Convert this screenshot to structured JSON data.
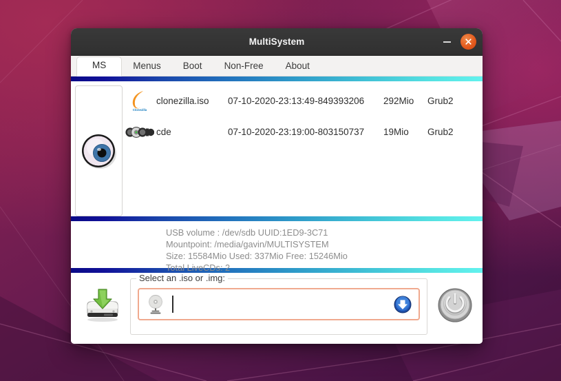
{
  "window": {
    "title": "MultiSystem",
    "minimize_label": "Minimize",
    "close_label": "Close"
  },
  "tabs": [
    {
      "label": "MS",
      "active": true
    },
    {
      "label": "Menus",
      "active": false
    },
    {
      "label": "Boot",
      "active": false
    },
    {
      "label": "Non-Free",
      "active": false
    },
    {
      "label": "About",
      "active": false
    }
  ],
  "preview": {
    "icon": "eyeball-icon"
  },
  "file_list": {
    "rows": [
      {
        "icon": "clonezilla-logo-icon",
        "name": "clonezilla.iso",
        "date": "07-10-2020-23:13:49-849393206",
        "size": "292Mio",
        "boot": "Grub2"
      },
      {
        "icon": "tinycore-logo-icon",
        "name": "cde",
        "date": "07-10-2020-23:19:00-803150737",
        "size": "19Mio",
        "boot": "Grub2"
      }
    ]
  },
  "info": {
    "lines": [
      "USB volume : /dev/sdb UUID:1ED9-3C71",
      "Mountpoint: /media/gavin/MULTISYSTEM",
      "Size: 15584Mio Used: 337Mio Free: 15246Mio",
      "Total LiveCDs: 2"
    ]
  },
  "bottom": {
    "hdd_icon": "hard-drive-download-icon",
    "iso_legend": "Select an .iso or .img:",
    "cd_icon": "cd-disc-icon",
    "iso_value": "",
    "iso_placeholder": "",
    "download_icon": "download-arrow-icon",
    "power_icon": "power-button-icon"
  },
  "colors": {
    "accent_gradient_start": "#0a0a87",
    "accent_gradient_end": "#62f2ee",
    "close_button": "#e2581c",
    "field_border": "#f0a98e",
    "titlebar": "#333333",
    "info_text": "#8d8d8d"
  }
}
